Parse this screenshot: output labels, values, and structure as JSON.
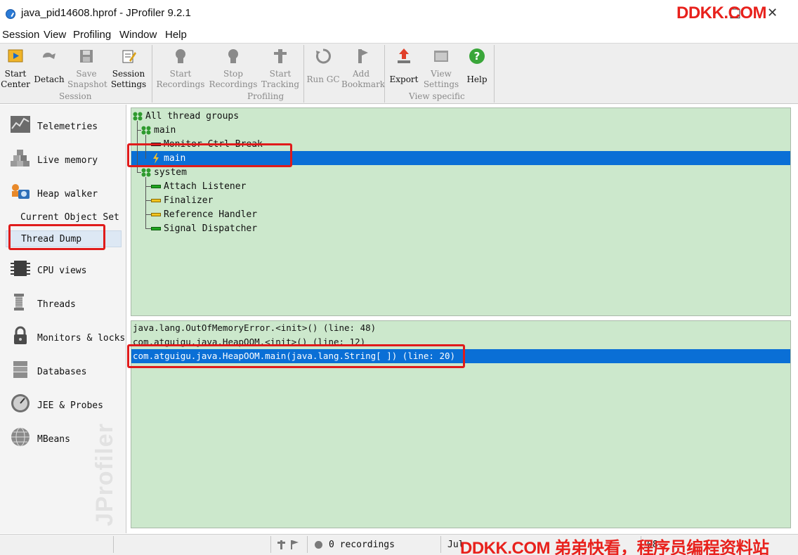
{
  "window": {
    "title": "java_pid14608.hprof - JProfiler 9.2.1",
    "watermark_top": "DDKK.COM",
    "restore_glyph": "□",
    "close_glyph": "✕"
  },
  "menu": [
    "Session",
    "View",
    "Profiling",
    "Window",
    "Help"
  ],
  "toolbar": {
    "start_center": "Start\nCenter",
    "detach": "Detach",
    "save_snapshot": "Save\nSnapshot",
    "session_settings": "Session\nSettings",
    "start_recordings": "Start\nRecordings",
    "stop_recordings": "Stop\nRecordings",
    "start_tracking": "Start\nTracking",
    "run_gc": "Run GC",
    "add_bookmark": "Add\nBookmark",
    "export": "Export",
    "view_settings": "View\nSettings",
    "help": "Help",
    "group_session": "Session",
    "group_profiling": "Profiling",
    "group_view_specific": "View specific"
  },
  "nav": {
    "telemetries": "Telemetries",
    "live_memory": "Live memory",
    "heap_walker": "Heap walker",
    "current_object_set": "Current Object Set",
    "thread_dump": "Thread Dump",
    "cpu_views": "CPU views",
    "threads": "Threads",
    "monitors_locks": "Monitors & locks",
    "databases": "Databases",
    "jee_probes": "JEE & Probes",
    "mbeans": "MBeans",
    "brand_watermark": "JProfiler"
  },
  "thread_tree": {
    "all_groups": "All thread groups",
    "group_main": "main",
    "monitor_ctrl_break": "Monitor Ctrl-Break",
    "thread_main": "main",
    "group_system": "system",
    "attach_listener": "Attach Listener",
    "finalizer": "Finalizer",
    "reference_handler": "Reference Handler",
    "signal_dispatcher": "Signal Dispatcher"
  },
  "stack_trace": [
    "java.lang.OutOfMemoryError.<init>() (line: 48)",
    "com.atguigu.java.HeapOOM.<init>() (line: 12)",
    "com.atguigu.java.HeapOOM.main(java.lang.String[ ]) (line: 20)"
  ],
  "status": {
    "recordings": "0 recordings",
    "date_fragment": "Jul",
    "time_fragment": "08"
  },
  "watermark_bottom": "DDKK.COM 弟弟快看，程序员编程资料站",
  "colors": {
    "panel_bg": "#cce8cc",
    "selection": "#0a6fd6",
    "highlight_box": "#e01b1b",
    "watermark": "#e8211c"
  }
}
